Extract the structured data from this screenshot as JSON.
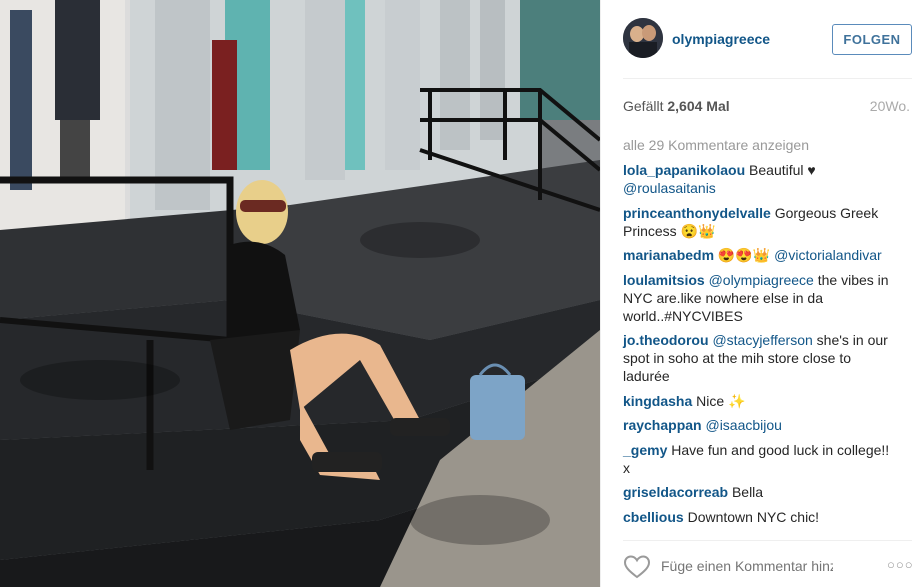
{
  "post": {
    "username": "olympiagreece",
    "follow_label": "FOLGEN",
    "likes_prefix": "Gefällt",
    "likes_count": "2,604",
    "likes_suffix": "Mal",
    "time_ago": "20Wo.",
    "load_more": "alle 29 Kommentare anzeigen",
    "comment_placeholder": "Füge einen Kommentar hinzu...",
    "more_options": "○○○"
  },
  "comments": [
    {
      "user": "lola_papanikolaou",
      "text": " Beautiful ♥ ",
      "mention": "@roulasaitanis",
      "after": ""
    },
    {
      "user": "princeanthonydelvalle",
      "text": " Gorgeous Greek Princess 😧👑",
      "mention": "",
      "after": ""
    },
    {
      "user": "marianabedm",
      "text": " 😍😍👑 ",
      "mention": "@victorialandivar",
      "after": ""
    },
    {
      "user": "loulamitsios",
      "text": " ",
      "mention": "@olympiagreece",
      "after": " the vibes in NYC are.like nowhere else in da world..#NYCVIBES"
    },
    {
      "user": "jo.theodorou",
      "text": " ",
      "mention": "@stacyjefferson",
      "after": " she's in our spot in soho at the mih store close to ladurée"
    },
    {
      "user": "kingdasha",
      "text": " Nice ✨",
      "mention": "",
      "after": ""
    },
    {
      "user": "raychappan",
      "text": " ",
      "mention": "@isaacbijou",
      "after": ""
    },
    {
      "user": "_gemy",
      "text": " Have fun and good luck in college!! x",
      "mention": "",
      "after": ""
    },
    {
      "user": "griseldacorreab",
      "text": " Bella",
      "mention": "",
      "after": ""
    },
    {
      "user": "cbellious",
      "text": " Downtown NYC chic!",
      "mention": "",
      "after": ""
    }
  ],
  "icons": {
    "heart": "heart-icon",
    "more": "more-options-icon"
  },
  "colors": {
    "link_blue": "#125688",
    "follow_border": "#5a8bbb",
    "muted": "#999999"
  }
}
